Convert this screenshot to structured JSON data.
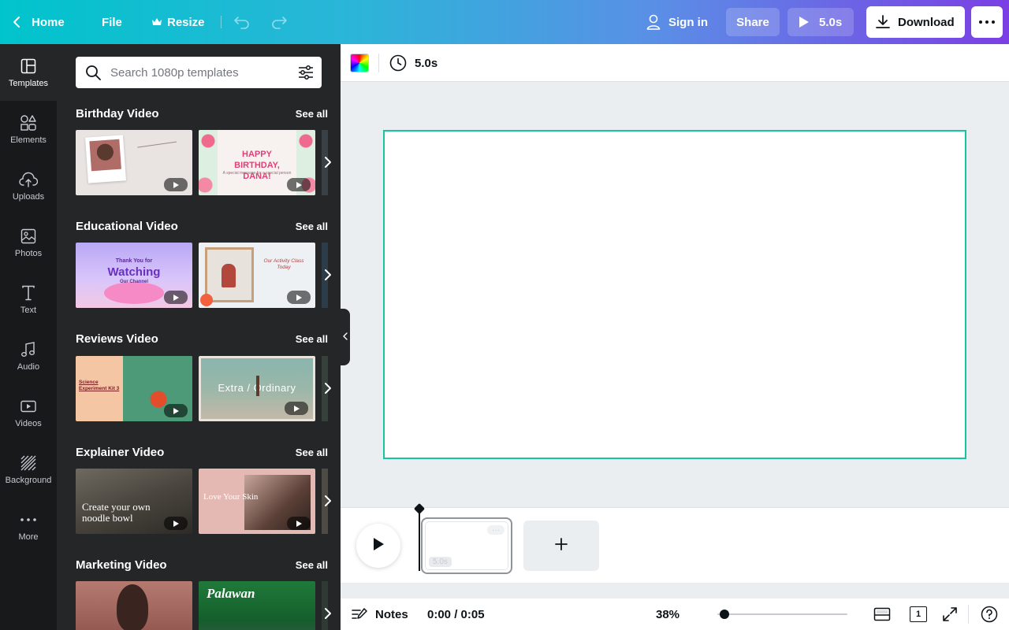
{
  "topbar": {
    "home_label": "Home",
    "file_label": "File",
    "resize_label": "Resize",
    "signin_label": "Sign in",
    "share_label": "Share",
    "play_label": "5.0s",
    "download_label": "Download",
    "icons": {
      "back": "chevron-left-icon",
      "resize": "crown-icon",
      "undo": "undo-icon",
      "redo": "redo-icon",
      "user": "user-icon",
      "play": "play-icon",
      "download": "download-icon",
      "more": "more-horizontal-icon"
    }
  },
  "rail": {
    "items": [
      {
        "label": "Templates",
        "icon": "templates-icon",
        "active": true
      },
      {
        "label": "Elements",
        "icon": "elements-icon"
      },
      {
        "label": "Uploads",
        "icon": "upload-cloud-icon"
      },
      {
        "label": "Photos",
        "icon": "photo-icon"
      },
      {
        "label": "Text",
        "icon": "text-icon"
      },
      {
        "label": "Audio",
        "icon": "music-note-icon"
      },
      {
        "label": "Videos",
        "icon": "video-icon"
      },
      {
        "label": "Background",
        "icon": "background-hatch-icon"
      },
      {
        "label": "More",
        "icon": "more-dots-icon"
      }
    ]
  },
  "panel": {
    "search": {
      "placeholder": "Search 1080p templates",
      "value": ""
    },
    "see_all": "See all",
    "sections": [
      {
        "title": "Birthday Video",
        "see_all": "See all",
        "thumbs": [
          {
            "text": ""
          },
          {
            "text": "HAPPY BIRTHDAY, DANA!",
            "subtext": "A special message for a special person"
          }
        ]
      },
      {
        "title": "Educational Video",
        "see_all": "See all",
        "thumbs": [
          {
            "text": "Thank You for",
            "big": "Watching",
            "subtext": "Our Channel"
          },
          {
            "text": "Our Activity Class Today"
          }
        ]
      },
      {
        "title": "Reviews Video",
        "see_all": "See all",
        "thumbs": [
          {
            "text": "Science Experiment Kit 3"
          },
          {
            "text": "Extra / Ordinary"
          }
        ]
      },
      {
        "title": "Explainer Video",
        "see_all": "See all",
        "thumbs": [
          {
            "text": "Create your own noodle bowl"
          },
          {
            "text": "Love Your Skin"
          }
        ]
      },
      {
        "title": "Marketing Video",
        "see_all": "See all",
        "thumbs": [
          {
            "text": ""
          },
          {
            "text": "Palawan"
          }
        ]
      }
    ]
  },
  "editor": {
    "duration_label": "5.0s"
  },
  "timeline": {
    "clip_duration": "5.0s"
  },
  "footer": {
    "notes_label": "Notes",
    "time_label": "0:00 / 0:05",
    "zoom_label": "38%",
    "zoom_value": 0.02,
    "page_count": "1"
  },
  "colors": {
    "canvas_outline": "#13c6a1",
    "rail_bg": "#18191b",
    "panel_bg": "#252627"
  }
}
